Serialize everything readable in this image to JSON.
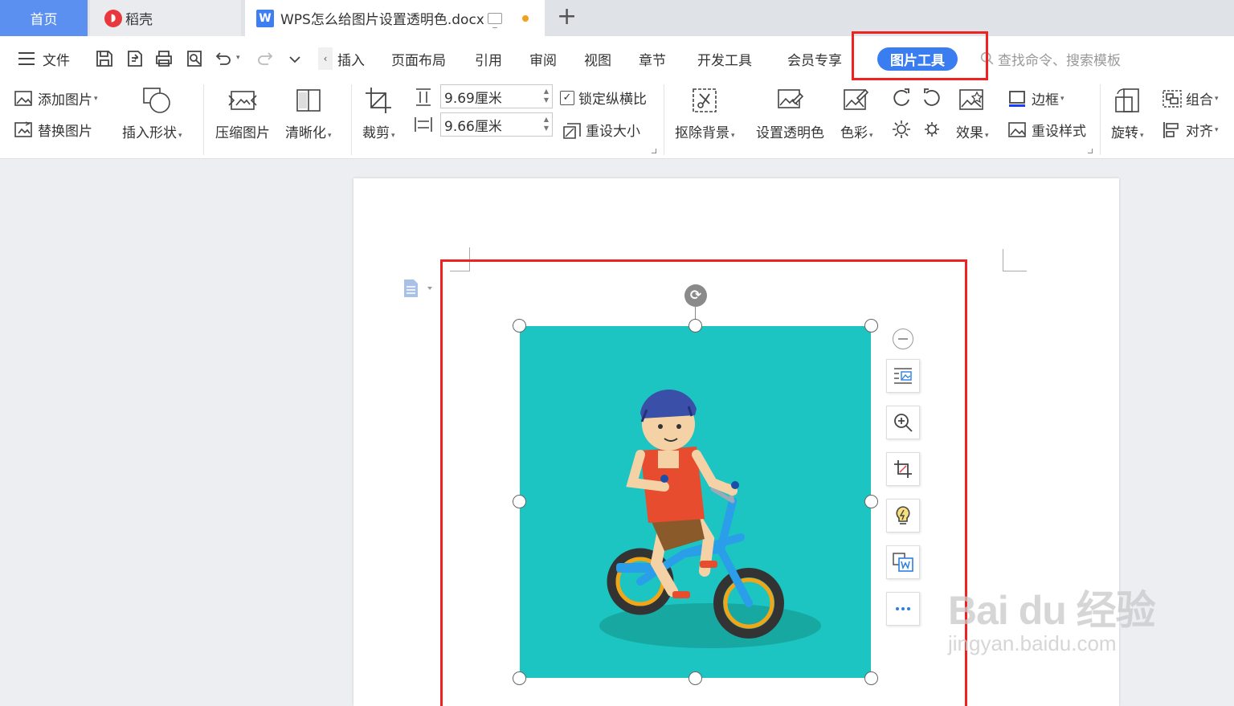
{
  "tabs": {
    "home": "首页",
    "daoke": "稻壳",
    "document": "WPS怎么给图片设置透明色.docx",
    "add": "+"
  },
  "menu": {
    "file": "文件",
    "items": [
      "插入",
      "页面布局",
      "引用",
      "审阅",
      "视图",
      "章节",
      "开发工具",
      "会员专享"
    ],
    "picture_tools": "图片工具",
    "search_placeholder": "查找命令、搜索模板"
  },
  "ribbon": {
    "add_picture": "添加图片",
    "replace_picture": "替换图片",
    "insert_shape": "插入形状",
    "compress_picture": "压缩图片",
    "sharpen": "清晰化",
    "crop": "裁剪",
    "height_value": "9.69厘米",
    "width_value": "9.66厘米",
    "lock_ratio": "锁定纵横比",
    "reset_size": "重设大小",
    "remove_background": "抠除背景",
    "set_transparent_color": "设置透明色",
    "color": "色彩",
    "effects": "效果",
    "border": "边框",
    "reset_style": "重设样式",
    "rotate": "旋转",
    "group": "组合",
    "align": "对齐"
  },
  "watermark": {
    "main": "Bai du 经验",
    "sub": "jingyan.baidu.com"
  },
  "colors": {
    "accent": "#3a7df0",
    "highlight": "#ee2222",
    "image_bg": "#1cc5c1"
  }
}
